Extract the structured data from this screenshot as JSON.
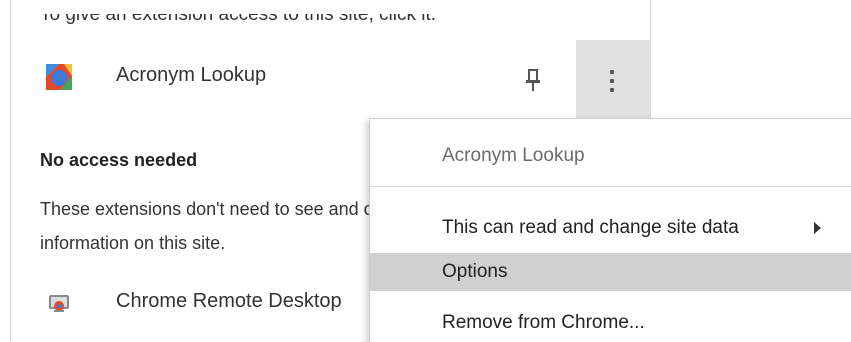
{
  "panel": {
    "hint_text": "To give an extension access to this site, click it.",
    "extension": {
      "name": "Acronym Lookup",
      "icon": "acronym-lookup-icon"
    },
    "no_access_section": {
      "title": "No access needed",
      "desc_line1": "These extensions don't need to see and change",
      "desc_line2": "information on this site."
    },
    "remote_extension": {
      "name": "Chrome Remote Desktop",
      "icon": "chrome-remote-desktop-icon"
    }
  },
  "context_menu": {
    "header": "Acronym Lookup",
    "items": [
      {
        "label": "This can read and change site data",
        "has_submenu": true
      },
      {
        "label": "Options",
        "highlighted": true
      },
      {
        "label": "Remove from Chrome..."
      }
    ]
  },
  "colors": {
    "highlight": "#d0d0d0",
    "more_button_bg": "#e0e0e0"
  }
}
